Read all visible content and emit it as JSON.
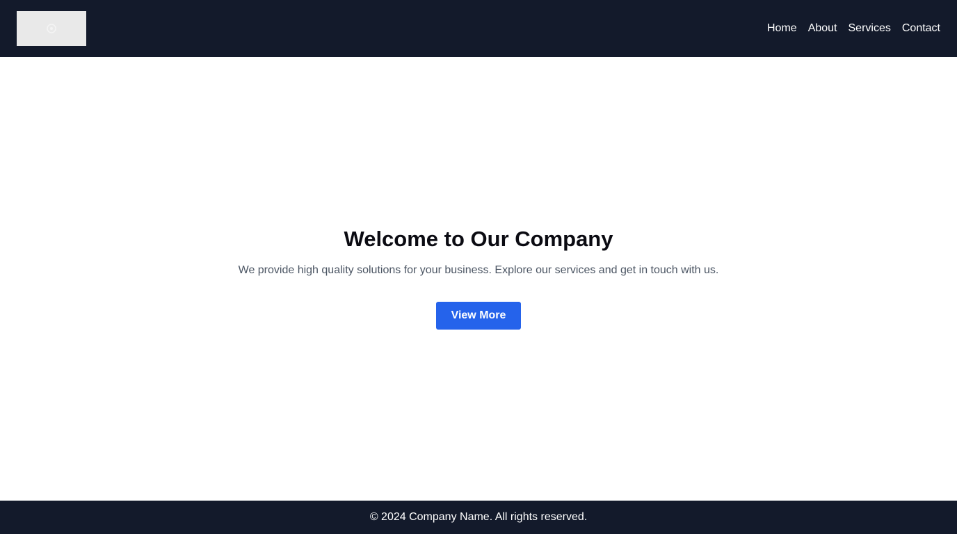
{
  "header": {
    "logo_icon": "image-placeholder-icon",
    "nav": [
      {
        "label": "Home"
      },
      {
        "label": "About"
      },
      {
        "label": "Services"
      },
      {
        "label": "Contact"
      }
    ]
  },
  "hero": {
    "title": "Welcome to Our Company",
    "subtitle": "We provide high quality solutions for your business. Explore our services and get in touch with us.",
    "cta_label": "View More"
  },
  "footer": {
    "copyright": "© 2024 Company Name. All rights reserved."
  },
  "colors": {
    "header_bg": "#131a2b",
    "footer_bg": "#131a2b",
    "accent": "#2563eb",
    "title": "#0b0b12",
    "subtitle": "#4b5563"
  }
}
